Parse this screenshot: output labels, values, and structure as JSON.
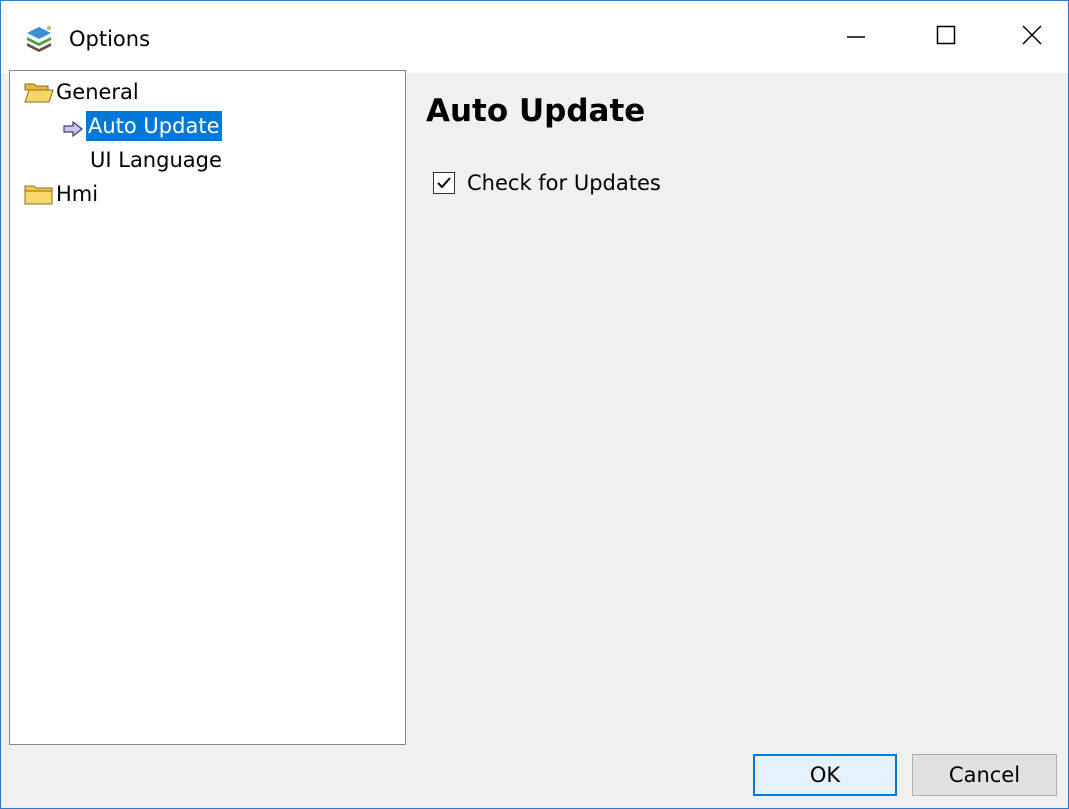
{
  "window": {
    "title": "Options",
    "icon": "app-layers-icon",
    "controls": {
      "minimize": "minimize-icon",
      "maximize": "maximize-icon",
      "close": "close-icon"
    }
  },
  "tree": {
    "items": [
      {
        "label": "General",
        "icon": "folder-open-icon",
        "expanded": true
      },
      {
        "label": "Auto Update",
        "icon": "arrow-right-icon",
        "selected": true
      },
      {
        "label": "UI Language"
      },
      {
        "label": "Hmi",
        "icon": "folder-closed-icon",
        "expanded": false
      }
    ]
  },
  "page": {
    "title": "Auto Update",
    "check_label": "Check for Updates",
    "check_checked": true
  },
  "buttons": {
    "ok": "OK",
    "cancel": "Cancel"
  },
  "colors": {
    "accent": "#0078d7",
    "window_border": "#2b79d0",
    "background": "#f0f0f0"
  }
}
